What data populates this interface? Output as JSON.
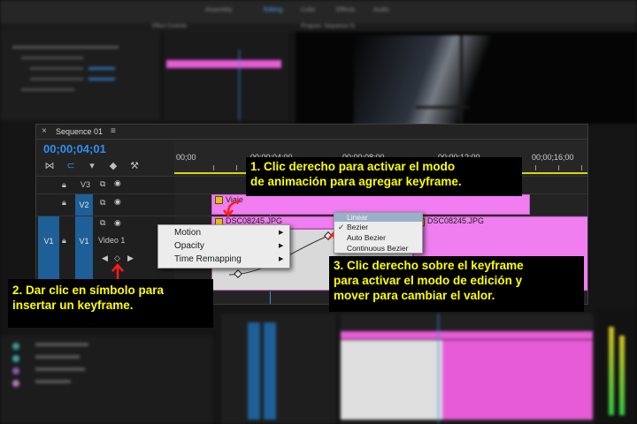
{
  "workspace": {
    "tabs": [
      "Assembly",
      "Editing",
      "Color",
      "Effects",
      "Audio"
    ],
    "active_tab": "Editing"
  },
  "effect_controls": {
    "title": "Effect Controls",
    "clip_label": "DSC08245.JPG"
  },
  "program_monitor": {
    "title": "Program: Sequence 01"
  },
  "timeline": {
    "title": "Sequence 01",
    "menu_icon": "hamburger-icon",
    "timecode": "00;00;04;01",
    "ruler": [
      "00;00",
      "00;00;04;00",
      "00;00;08;00",
      "00;00;12;00",
      "00;00;16;00"
    ],
    "tracks": [
      {
        "target": "",
        "name": "V3",
        "label": ""
      },
      {
        "target": "",
        "name": "V2",
        "label": ""
      },
      {
        "target": "V1",
        "name": "V1",
        "label": "Video 1"
      }
    ],
    "clips": {
      "v2_clip": "Viaje",
      "v1_clip_a": "DSC08245.JPG",
      "v1_clip_b": "DSC08245.JPG"
    },
    "fx_badge": "fx"
  },
  "context_menu_left": {
    "items": [
      "Motion",
      "Opacity",
      "Time Remapping"
    ]
  },
  "context_menu_right": {
    "items": [
      {
        "label": "Linear",
        "checked": false,
        "highlighted": true
      },
      {
        "label": "Bezier",
        "checked": true,
        "highlighted": false
      },
      {
        "label": "Auto Bezier",
        "checked": false,
        "highlighted": false
      },
      {
        "label": "Continuous Bezier",
        "checked": false,
        "highlighted": false
      }
    ],
    "check_glyph": "✓"
  },
  "callouts": {
    "c1": [
      "1. Clic derecho para activar el modo",
      "de animación para agregar keyframe."
    ],
    "c2": [
      "2. Dar clic en símbolo para",
      "insertar un keyframe."
    ],
    "c3": [
      "3. Clic derecho sobre el keyframe",
      "para activar el modo de edición y",
      "mover para cambiar el valor."
    ]
  },
  "colors": {
    "accent_blue": "#2f8ff0",
    "clip_pink": "#f07ef0",
    "callout_text": "#ffff00",
    "arrow_red": "#ff1a1a"
  }
}
